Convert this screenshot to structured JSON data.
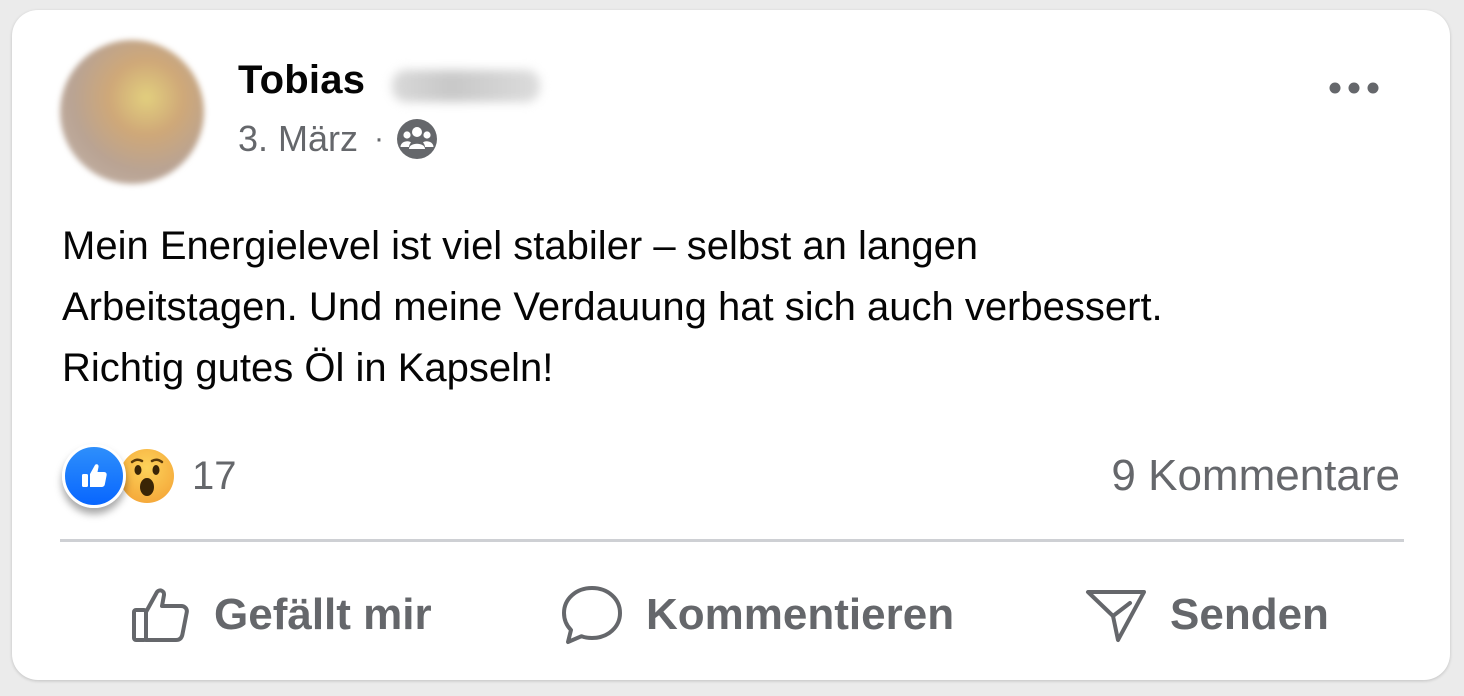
{
  "post": {
    "author_first_name": "Tobias",
    "date": "3. März",
    "separator": "·",
    "audience_icon": "friends-icon",
    "text_lines": [
      "Mein Energielevel ist viel stabiler – selbst an langen",
      "Arbeitstagen. Und meine Verdauung hat sich auch verbessert.",
      "Richtig gutes Öl in Kapseln!"
    ],
    "reactions": {
      "types": [
        "like",
        "wow"
      ],
      "count": "17"
    },
    "comments_label": "9 Kommentare"
  },
  "actions": {
    "like_label": "Gefällt mir",
    "comment_label": "Kommentieren",
    "send_label": "Senden"
  },
  "colors": {
    "card_background": "#ffffff",
    "page_background": "#ebebeb",
    "primary_text": "#050505",
    "secondary_text": "#65676b",
    "like_blue": "#0866ff",
    "divider": "#ced0d4"
  }
}
